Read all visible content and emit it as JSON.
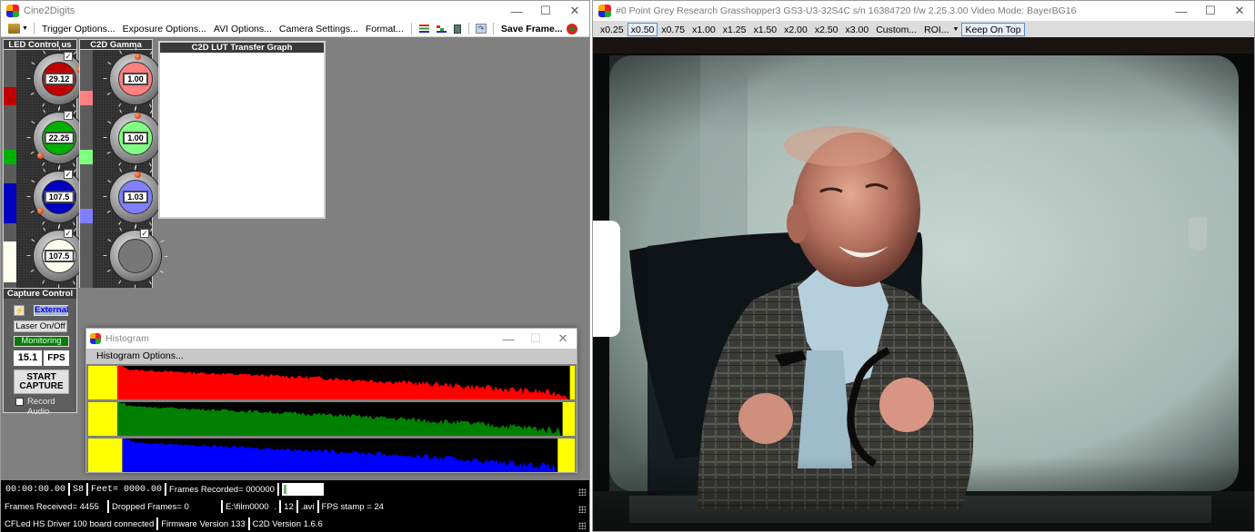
{
  "app": {
    "title": "Cine2Digits",
    "menu": [
      "Trigger Options...",
      "Exposure Options...",
      "AVI Options...",
      "Camera Settings...",
      "Format..."
    ],
    "save_frame": "Save Frame...",
    "icons": [
      "folder-open-icon",
      "rgb-lines-icon",
      "bars-icon",
      "film-icon",
      "rotate-icon",
      "gear-icon"
    ]
  },
  "led_panel": {
    "title": "LED Control us",
    "knobs": [
      {
        "value": "29.12",
        "color": "#c00000",
        "checked": true
      },
      {
        "value": "22.25",
        "color": "#00b000",
        "checked": true
      },
      {
        "value": "107.5",
        "color": "#0000c0",
        "checked": true
      },
      {
        "value": "107.5",
        "color": "#fffff0",
        "checked": true
      }
    ]
  },
  "gamma_panel": {
    "title": "C2D Gamma",
    "knobs": [
      {
        "value": "1.00",
        "color": "#ff8080",
        "checked": false
      },
      {
        "value": "1.00",
        "color": "#80ff80",
        "checked": false
      },
      {
        "value": "1.03",
        "color": "#8080ff",
        "checked": false
      },
      {
        "value": "",
        "color": "#777777",
        "checked": true
      }
    ]
  },
  "lut_graph": {
    "title": "C2D LUT Transfer Graph"
  },
  "capture": {
    "title": "Capture Control",
    "trigger_mode": "External",
    "laser": "Laser On/Off",
    "state": "Monitoring",
    "fps_value": "15.1",
    "fps_unit": "FPS",
    "start": [
      "START",
      "CAPTURE"
    ],
    "record_audio": "Record Audio",
    "record_audio_checked": false
  },
  "histogram": {
    "title": "Histogram",
    "menu": "Histogram Options...",
    "channels": [
      {
        "name": "red",
        "color": "#ff0000",
        "low_clip": 0.06,
        "high_clip": 0.99
      },
      {
        "name": "green",
        "color": "#008000",
        "low_clip": 0.06,
        "high_clip": 0.975
      },
      {
        "name": "blue",
        "color": "#0000ff",
        "low_clip": 0.07,
        "high_clip": 0.965
      }
    ],
    "clip_color": "#ffff00"
  },
  "status": {
    "timecode": "00:00:00.00",
    "format": "S8",
    "feet": "Feet= 0000.00",
    "frames_recorded": "Frames Recorded= 000000",
    "frames_received": "Frames Received=  4455",
    "dropped": "Dropped Frames=  0",
    "file_base": "E:\\film0000",
    "file_dot": ".",
    "file_num": "12",
    "file_ext": ".avi",
    "fps_stamp": "FPS stamp = 24",
    "driver": "CFLed HS Driver 100 board connected",
    "firmware": "Firmware Version 133",
    "version": "C2D Version 1.6.6"
  },
  "camera": {
    "title": "#0 Point Grey Research Grasshopper3 GS3-U3-32S4C s/n 16384720 f/w 2.25.3.00  Video Mode: BayerBG16",
    "zoom_options": [
      "x0.25",
      "x0.50",
      "x0.75",
      "x1.00",
      "x1.25",
      "x1.50",
      "x2.00",
      "x2.50",
      "x3.00",
      "Custom..."
    ],
    "zoom_selected": "x0.50",
    "roi": "ROI...",
    "keep_on_top": "Keep On Top",
    "frame_description": "Scanned film frame: smiling balding man in plaid cardigan and light blue shirt seated in dark chair, holding film strip"
  },
  "window_controls": {
    "minimize": "—",
    "maximize": "☐",
    "close": "✕"
  }
}
